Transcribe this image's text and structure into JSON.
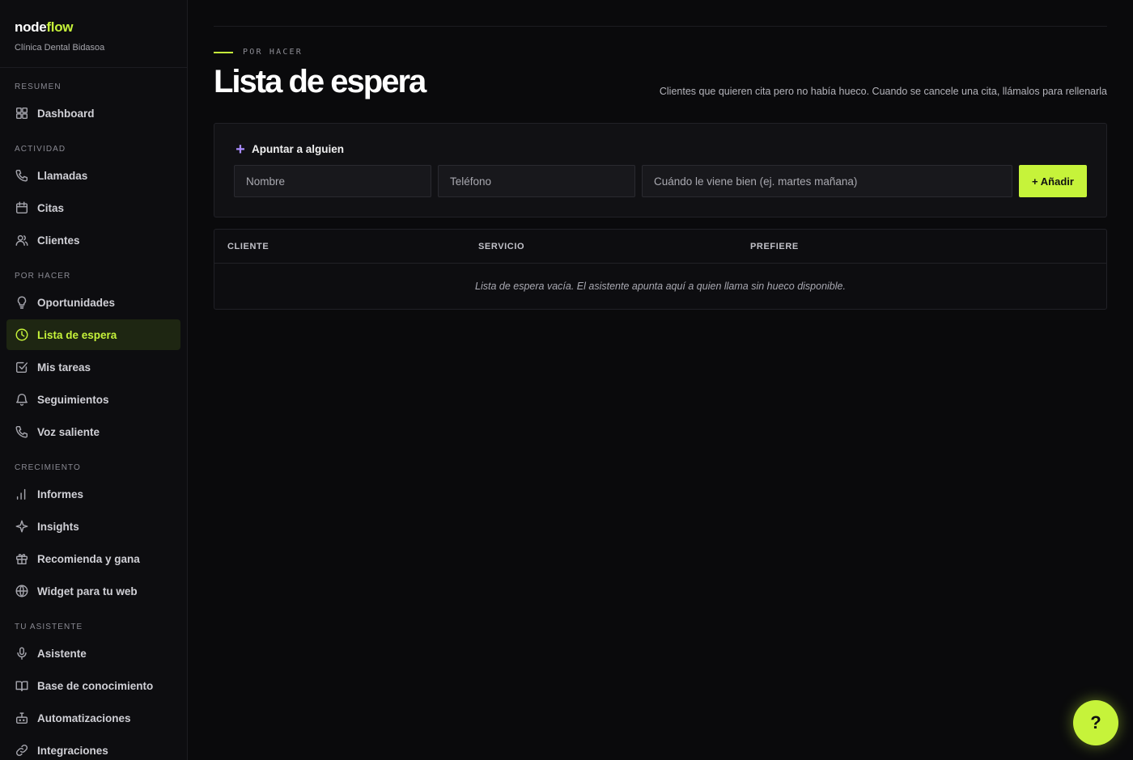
{
  "brand": {
    "name_part1": "node",
    "name_part2": "flow",
    "subtitle": "Clínica Dental Bidasoa"
  },
  "sidebar": {
    "sections": [
      {
        "label": "RESUMEN",
        "items": [
          {
            "label": "Dashboard",
            "icon": "grid-icon"
          }
        ]
      },
      {
        "label": "ACTIVIDAD",
        "items": [
          {
            "label": "Llamadas",
            "icon": "phone-icon"
          },
          {
            "label": "Citas",
            "icon": "calendar-icon"
          },
          {
            "label": "Clientes",
            "icon": "users-icon"
          }
        ]
      },
      {
        "label": "POR HACER",
        "items": [
          {
            "label": "Oportunidades",
            "icon": "lightbulb-icon"
          },
          {
            "label": "Lista de espera",
            "icon": "clock-icon",
            "active": true
          },
          {
            "label": "Mis tareas",
            "icon": "checkbox-icon"
          },
          {
            "label": "Seguimientos",
            "icon": "bell-icon"
          },
          {
            "label": "Voz saliente",
            "icon": "phone-icon"
          }
        ]
      },
      {
        "label": "CRECIMIENTO",
        "items": [
          {
            "label": "Informes",
            "icon": "bar-chart-icon"
          },
          {
            "label": "Insights",
            "icon": "sparkle-icon"
          },
          {
            "label": "Recomienda y gana",
            "icon": "gift-icon"
          },
          {
            "label": "Widget para tu web",
            "icon": "globe-icon"
          }
        ]
      },
      {
        "label": "TU ASISTENTE",
        "items": [
          {
            "label": "Asistente",
            "icon": "microphone-icon"
          },
          {
            "label": "Base de conocimiento",
            "icon": "book-icon"
          },
          {
            "label": "Automatizaciones",
            "icon": "bot-icon"
          },
          {
            "label": "Integraciones",
            "icon": "link-icon"
          }
        ]
      }
    ]
  },
  "header": {
    "eyebrow": "POR HACER",
    "title": "Lista de espera",
    "description": "Clientes que quieren cita pero no había hueco. Cuando se cancele una cita, llámalos para rellenarla"
  },
  "form": {
    "title": "Apuntar a alguien",
    "name_placeholder": "Nombre",
    "phone_placeholder": "Teléfono",
    "when_placeholder": "Cuándo le viene bien (ej. martes mañana)",
    "add_label": "+ Añadir"
  },
  "table": {
    "columns": [
      "CLIENTE",
      "SERVICIO",
      "PREFIERE"
    ],
    "empty_text": "Lista de espera vacía. El asistente apunta aquí a quien llama sin hueco disponible."
  },
  "help": {
    "label": "?"
  },
  "colors": {
    "accent": "#c6f33a",
    "purple": "#a98bff",
    "background": "#0a0a0c"
  }
}
